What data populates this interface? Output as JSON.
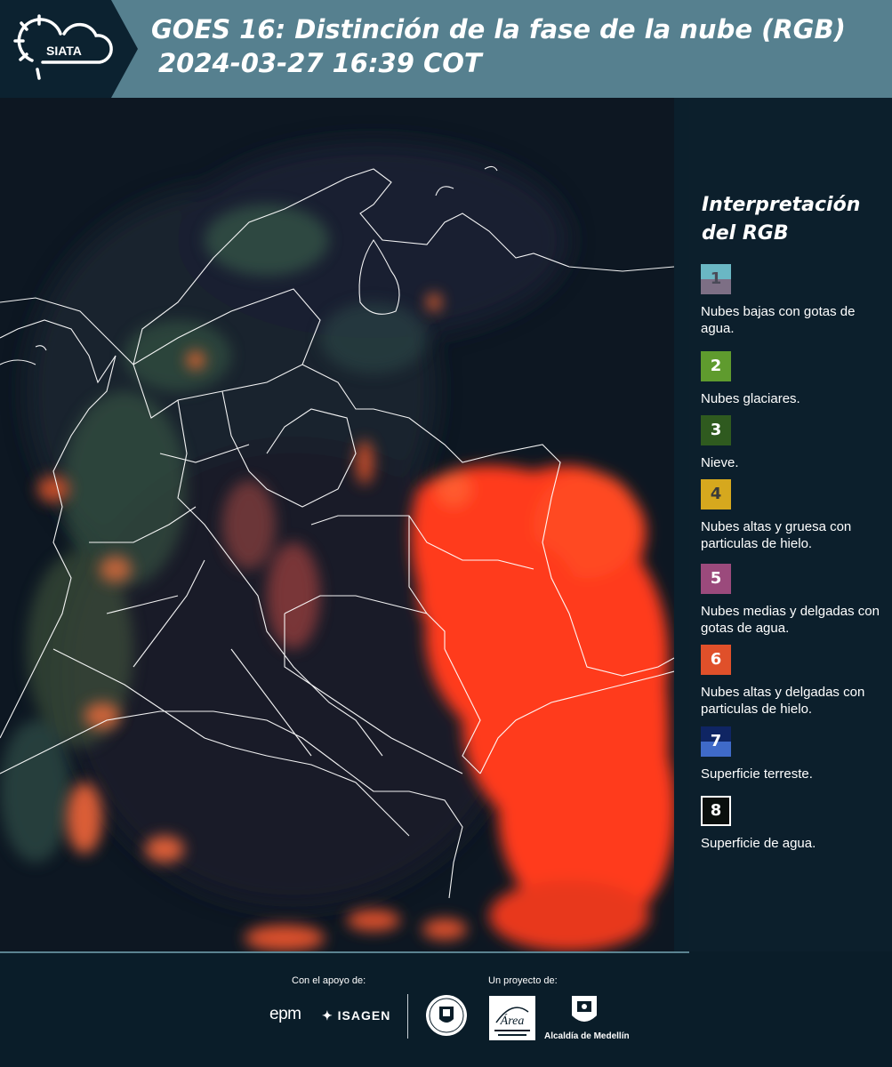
{
  "header": {
    "logo_text": "SIATA",
    "title_line1": "GOES 16: Distinción de la fase de la nube (RGB)",
    "title_line2": "2024-03-27 16:39 COT",
    "band_color": "#56808f",
    "dark_color": "#0c2230"
  },
  "map": {
    "description_icon": "satellite-rgb-image",
    "border_color": "#ffffff",
    "background_color": "#0d1722",
    "cloud_color": "#ff3a1e"
  },
  "legend": {
    "title_line1": "Interpretación",
    "title_line2": "del RGB",
    "items": [
      {
        "number": "1",
        "label": "Nubes bajas con gotas de agua.",
        "color_top": "#6ab7c4",
        "color_bottom": "#7d6f85",
        "num_color": "#4a4a58"
      },
      {
        "number": "2",
        "label": "Nubes glaciares.",
        "color_top": "#5f9b2e",
        "color_bottom": "#5f9b2e",
        "num_color": "#ffffff"
      },
      {
        "number": "3",
        "label": "Nieve.",
        "color_top": "#2f5a1f",
        "color_bottom": "#2f5a1f",
        "num_color": "#ffffff"
      },
      {
        "number": "4",
        "label": "Nubes altas y gruesa con particulas de hielo.",
        "color_top": "#d6a81e",
        "color_bottom": "#d6a81e",
        "num_color": "#3a3a3a"
      },
      {
        "number": "5",
        "label": "Nubes medias y delgadas con gotas de agua.",
        "color_top": "#9b4a7c",
        "color_bottom": "#9b4a7c",
        "num_color": "#ffffff"
      },
      {
        "number": "6",
        "label": "Nubes altas y delgadas con particulas de hielo.",
        "color_top": "#e0502a",
        "color_bottom": "#e0502a",
        "num_color": "#ffffff"
      },
      {
        "number": "7",
        "label": "Superficie terreste.",
        "color_top": "#0f2563",
        "color_bottom": "#3f6ac8",
        "num_color": "#ffffff"
      },
      {
        "number": "8",
        "label": "Superficie de agua.",
        "color_top": "#0a0f0d",
        "color_bottom": "#0a0f0d",
        "num_color": "#ffffff"
      }
    ]
  },
  "footer": {
    "support_label": "Con el apoyo de:",
    "project_label": "Un proyecto de:",
    "sponsor1": "epm",
    "sponsor2": "ISAGEN",
    "seal_icon": "medellin-seal-icon",
    "area_logo_text": "Área",
    "alcaldia_label": "Alcaldía de Medellín"
  }
}
